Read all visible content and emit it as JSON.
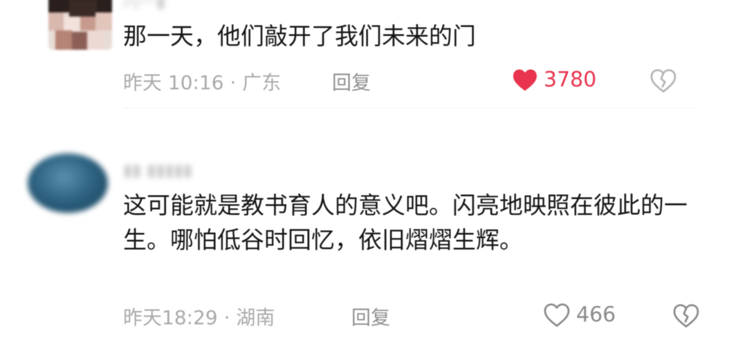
{
  "comments": [
    {
      "username": "闪一▮",
      "text": "那一天，他们敲开了我们未来的门",
      "time_location": "昨天 10:16 · 广东",
      "reply_label": "回复",
      "likes": "3780",
      "liked": true
    },
    {
      "username": "▮▮ ▮▮▮▮▮",
      "text": "这可能就是教书育人的意义吧。闪亮地映照在彼此的一生。哪怕低谷时回忆，依旧熠熠生辉。",
      "time_location": "昨天18:29 · 湖南",
      "reply_label": "回复",
      "likes": "466",
      "liked": false
    }
  ],
  "colors": {
    "like_active": "#e8344e",
    "meta_text": "#a9a9a9",
    "body_text": "#161616"
  },
  "icons": {
    "like": "heart-icon",
    "dislike": "broken-heart-icon"
  }
}
